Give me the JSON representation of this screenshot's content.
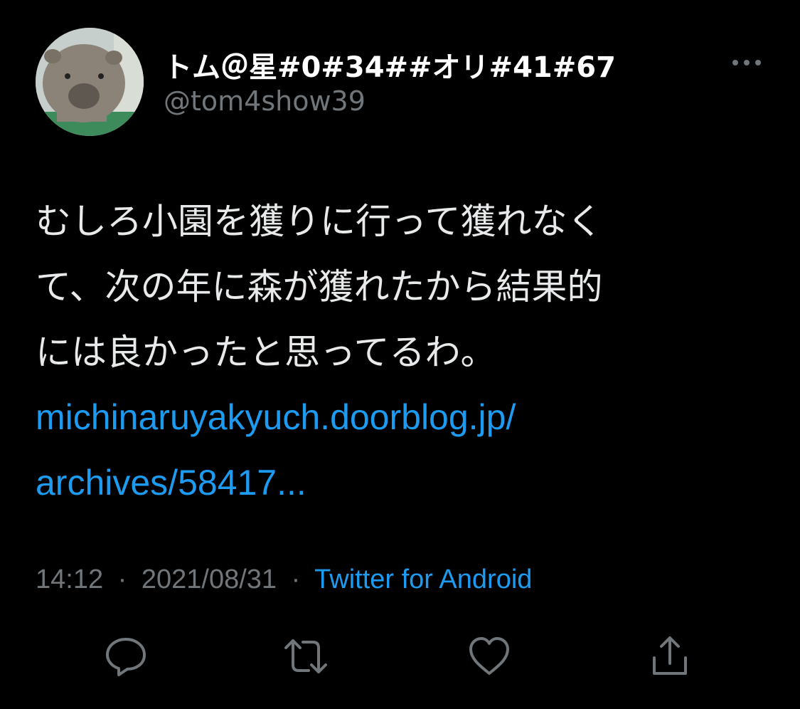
{
  "user": {
    "display_name": "トム＠星#0#34##オリ#41#67",
    "handle": "@tom4show39",
    "avatar_icon": "wombat-avatar"
  },
  "tweet": {
    "text_lines": [
      "むしろ小園を獲りに行って獲れなく",
      "て、次の年に森が獲れたから結果的",
      "には良かったと思ってるわ。"
    ],
    "link_lines": [
      " michinaruyakyuch.doorblog.jp/",
      "archives/58417..."
    ],
    "time": "14:12",
    "date": "2021/08/31",
    "separator": "·",
    "source": "Twitter for Android"
  },
  "icons": {
    "more": "more-icon",
    "reply": "reply-icon",
    "retweet": "retweet-icon",
    "like": "like-icon",
    "share": "share-icon"
  },
  "colors": {
    "background": "#000000",
    "text": "#e7e9ea",
    "secondary": "#71767b",
    "link": "#1d9bf0"
  }
}
